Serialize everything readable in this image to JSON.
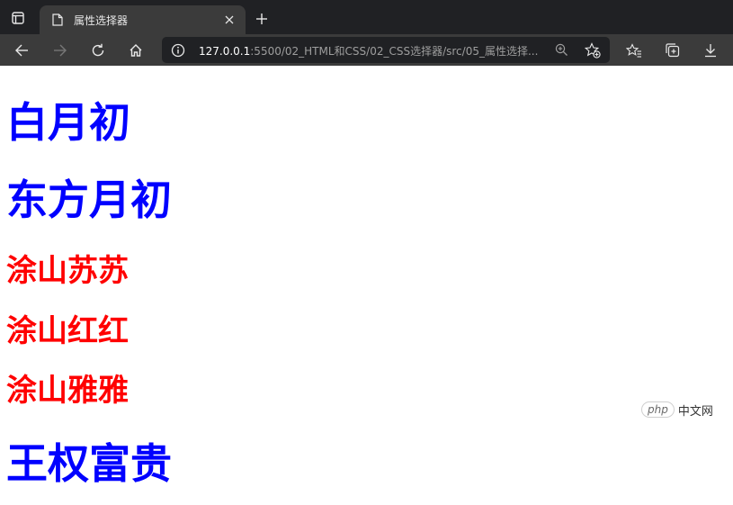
{
  "browser": {
    "tab": {
      "title": "属性选择器"
    },
    "address_bar": {
      "host": "127.0.0.1",
      "path": ":5500/02_HTML和CSS/02_CSS选择器/src/05_属性选择..."
    }
  },
  "page": {
    "headings": [
      {
        "text": "白月初",
        "color": "#0000ff"
      },
      {
        "text": "东方月初",
        "color": "#0000ff"
      },
      {
        "text": "涂山苏苏",
        "color": "#ff0000"
      },
      {
        "text": "涂山红红",
        "color": "#ff0000"
      },
      {
        "text": "涂山雅雅",
        "color": "#ff0000"
      },
      {
        "text": "王权富贵",
        "color": "#0000ff"
      }
    ]
  },
  "watermark": {
    "badge": "php",
    "text": "中文网"
  }
}
